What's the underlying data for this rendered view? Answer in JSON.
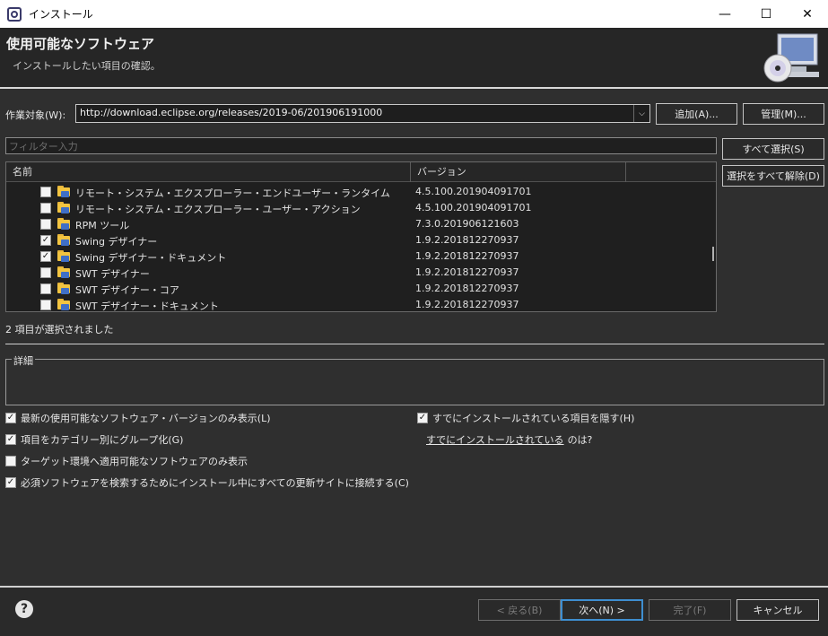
{
  "window": {
    "title": "インストール",
    "minimize": "—",
    "maximize": "☐",
    "close": "✕"
  },
  "header": {
    "title": "使用可能なソフトウェア",
    "description": "インストールしたい項目の確認。"
  },
  "work_with": {
    "label": "作業対象(W):",
    "value": "http://download.eclipse.org/releases/2019-06/201906191000",
    "add_label": "追加(A)...",
    "manage_label": "管理(M)..."
  },
  "filter": {
    "placeholder": "フィルター入力"
  },
  "selection_buttons": {
    "select_all": "すべて選択(S)",
    "deselect_all": "選択をすべて解除(D)"
  },
  "table": {
    "columns": [
      "名前",
      "バージョン",
      ""
    ],
    "rows": [
      {
        "name": "リモート・システム・エクスプローラー・エンドユーザー・ランタイム",
        "version": "4.5.100.201904091701",
        "checked": false
      },
      {
        "name": "リモート・システム・エクスプローラー・ユーザー・アクション",
        "version": "4.5.100.201904091701",
        "checked": false
      },
      {
        "name": "RPM ツール",
        "version": "7.3.0.201906121603",
        "checked": false
      },
      {
        "name": "Swing デザイナー",
        "version": "1.9.2.201812270937",
        "checked": true
      },
      {
        "name": "Swing デザイナー・ドキュメント",
        "version": "1.9.2.201812270937",
        "checked": true
      },
      {
        "name": "SWT デザイナー",
        "version": "1.9.2.201812270937",
        "checked": false
      },
      {
        "name": "SWT デザイナー・コア",
        "version": "1.9.2.201812270937",
        "checked": false
      },
      {
        "name": "SWT デザイナー・ドキュメント",
        "version": "1.9.2.201812270937",
        "checked": false
      }
    ]
  },
  "status": "2 項目が選択されました",
  "details": {
    "label": "詳細"
  },
  "options": {
    "latest_only": {
      "label": "最新の使用可能なソフトウェア・バージョンのみ表示(L)",
      "checked": true
    },
    "group_by_category": {
      "label": "項目をカテゴリー別にグループ化(G)",
      "checked": true
    },
    "target_env": {
      "label": "ターゲット環境へ適用可能なソフトウェアのみ表示",
      "checked": false
    },
    "contact_all_sites": {
      "label": "必須ソフトウェアを検索するためにインストール中にすべての更新サイトに接続する(C)",
      "checked": true
    },
    "hide_installed": {
      "label": "すでにインストールされている項目を隠す(H)",
      "checked": true
    },
    "installed_link": "すでにインストールされている",
    "installed_suffix": "のは?"
  },
  "footer": {
    "help": "?",
    "back": "< 戻る(B)",
    "next": "次へ(N) >",
    "finish": "完了(F)",
    "cancel": "キャンセル"
  },
  "colors": {
    "accent": "#3e8ed0",
    "link": "#5aa8ff",
    "background": "#2f2f2f"
  }
}
